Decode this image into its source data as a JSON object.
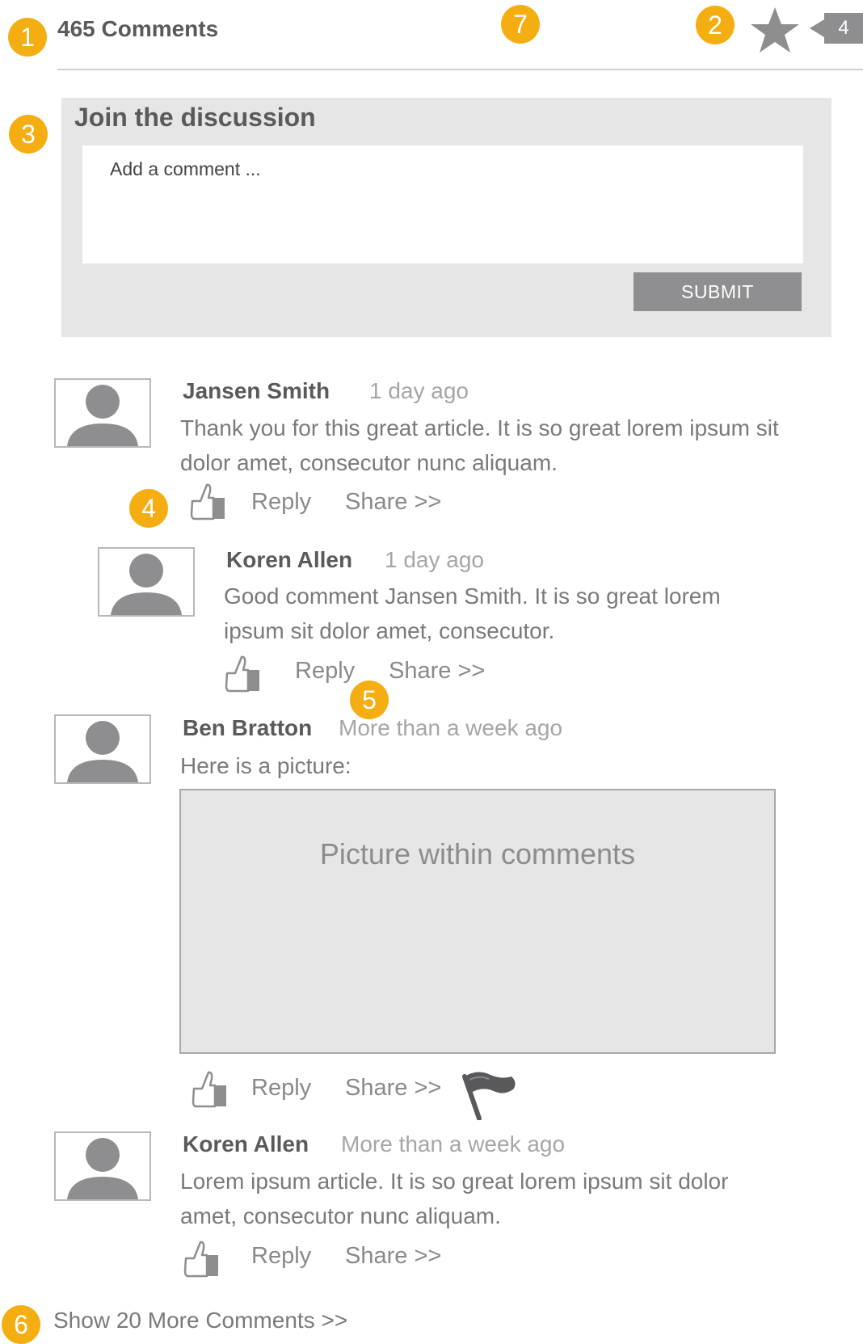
{
  "header": {
    "comment_count_label": "465 Comments",
    "badge_count": "4"
  },
  "markers": [
    "1",
    "2",
    "3",
    "4",
    "5",
    "6",
    "7"
  ],
  "discussion": {
    "title": "Join the discussion",
    "placeholder": "Add a comment ...",
    "submit_label": "SUBMIT"
  },
  "comments": [
    {
      "author": "Jansen Smith",
      "time": "1 day ago",
      "body_line1": "Thank you for this great article. It is so great lorem ipsum sit",
      "body_line2": "dolor amet, consecutor nunc aliquam.",
      "reply_label": "Reply",
      "share_label": "Share >>"
    },
    {
      "author": "Koren Allen",
      "time": "1 day ago",
      "body_line1": "Good comment Jansen Smith. It is so great lorem",
      "body_line2": "ipsum sit dolor amet, consecutor.",
      "reply_label": "Reply",
      "share_label": "Share >>"
    },
    {
      "author": "Ben Bratton",
      "time": "More than a week ago",
      "body_line1": "Here is a picture:",
      "picture_label": "Picture within comments",
      "reply_label": "Reply",
      "share_label": "Share >>"
    },
    {
      "author": "Koren Allen",
      "time": "More than a week ago",
      "body_line1": "Lorem ipsum article. It is so great lorem ipsum sit dolor",
      "body_line2": "amet, consecutor nunc aliquam.",
      "reply_label": "Reply",
      "share_label": "Share >>"
    }
  ],
  "footer": {
    "show_more_label": "Show 20 More Comments >>"
  },
  "colors": {
    "marker": "#f5ae12",
    "panel": "#e6e6e7",
    "submit": "#8f8f91",
    "icon": "#8e8e90"
  },
  "icons": [
    "star-icon",
    "count-badge",
    "avatar-icon",
    "thumbs-up-icon",
    "flag-icon"
  ]
}
